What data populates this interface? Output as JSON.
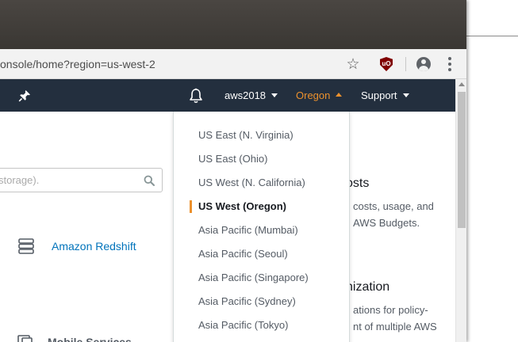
{
  "browser": {
    "url": "onsole/home?region=us-west-2"
  },
  "icons": {
    "bookmark": "star-icon",
    "extension": "ublock-origin-icon",
    "profile": "profile-icon",
    "menu": "kebab-menu-icon",
    "pin": "pin-icon",
    "notifications": "bell-icon",
    "search": "search-icon"
  },
  "navbar": {
    "account_label": "aws2018",
    "region_label": "Oregon",
    "support_label": "Support"
  },
  "search": {
    "placeholder": "storage)."
  },
  "services": {
    "redshift_label": "Amazon Redshift",
    "mobile_label": "Mobile Services"
  },
  "promos": {
    "costs_title": "osts",
    "costs_line1": "costs, usage, and",
    "costs_line2": "AWS Budgets.",
    "org_title": "nization",
    "org_line1": "ations for policy-",
    "org_line2": "nt of multiple AWS"
  },
  "region_dropdown": {
    "items": [
      {
        "label": "US East (N. Virginia)",
        "selected": false
      },
      {
        "label": "US East (Ohio)",
        "selected": false
      },
      {
        "label": "US West (N. California)",
        "selected": false
      },
      {
        "label": "US West (Oregon)",
        "selected": true
      },
      {
        "label": "Asia Pacific (Mumbai)",
        "selected": false
      },
      {
        "label": "Asia Pacific (Seoul)",
        "selected": false
      },
      {
        "label": "Asia Pacific (Singapore)",
        "selected": false
      },
      {
        "label": "Asia Pacific (Sydney)",
        "selected": false
      },
      {
        "label": "Asia Pacific (Tokyo)",
        "selected": false
      }
    ]
  },
  "colors": {
    "navbar_bg": "#232f3e",
    "region_accent": "#ec912d",
    "link": "#0073bb"
  }
}
